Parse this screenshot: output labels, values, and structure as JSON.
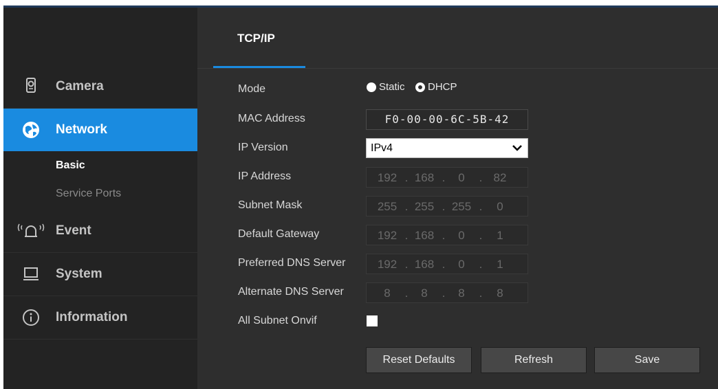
{
  "sidebar": {
    "items": [
      {
        "label": "Camera",
        "icon": "camera-icon"
      },
      {
        "label": "Network",
        "icon": "network-globe-icon"
      },
      {
        "label": "Event",
        "icon": "event-bell-icon"
      },
      {
        "label": "System",
        "icon": "monitor-icon"
      },
      {
        "label": "Information",
        "icon": "info-icon"
      }
    ],
    "sub_items": [
      {
        "label": "Basic"
      },
      {
        "label": "Service Ports"
      }
    ],
    "accent_color": "#1a8be0"
  },
  "tabs": [
    {
      "label": "TCP/IP"
    }
  ],
  "form": {
    "mode": {
      "label": "Mode",
      "options": [
        "Static",
        "DHCP"
      ],
      "selected": "DHCP"
    },
    "mac": {
      "label": "MAC Address",
      "value": "F0-00-00-6C-5B-42"
    },
    "ip_version": {
      "label": "IP Version",
      "value": "IPv4"
    },
    "ip_address": {
      "label": "IP Address",
      "octets": [
        "192",
        "168",
        "0",
        "82"
      ]
    },
    "subnet_mask": {
      "label": "Subnet Mask",
      "octets": [
        "255",
        "255",
        "255",
        "0"
      ]
    },
    "default_gateway": {
      "label": "Default Gateway",
      "octets": [
        "192",
        "168",
        "0",
        "1"
      ]
    },
    "preferred_dns": {
      "label": "Preferred DNS Server",
      "octets": [
        "192",
        "168",
        "0",
        "1"
      ]
    },
    "alternate_dns": {
      "label": "Alternate DNS Server",
      "octets": [
        "8",
        "8",
        "8",
        "8"
      ]
    },
    "all_subnet_onvif": {
      "label": "All Subnet Onvif",
      "checked": false
    }
  },
  "buttons": {
    "reset": "Reset Defaults",
    "refresh": "Refresh",
    "save": "Save"
  }
}
